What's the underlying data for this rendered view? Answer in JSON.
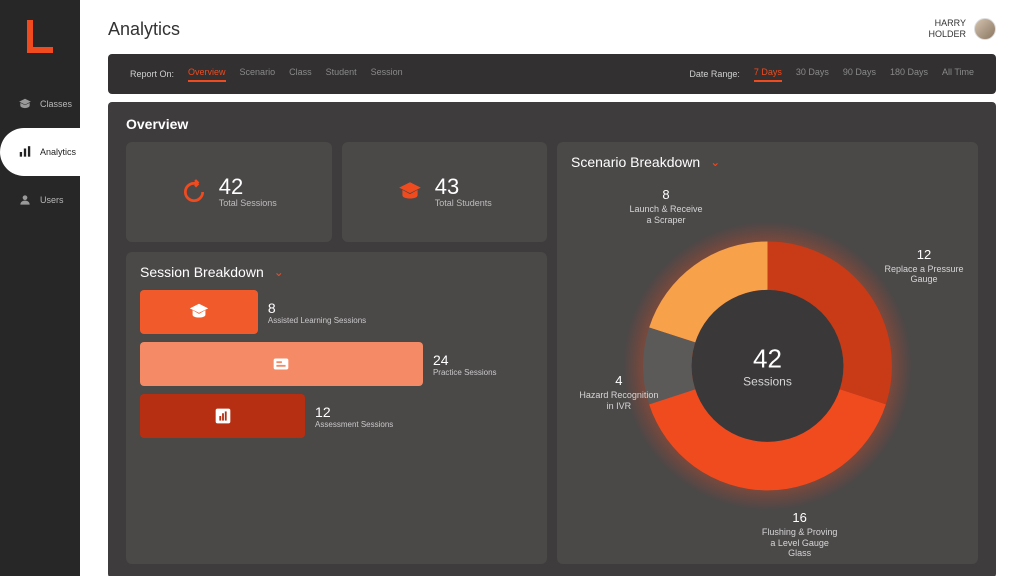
{
  "accent": "#f04b1f",
  "page_title": "Analytics",
  "user": {
    "first": "HARRY",
    "last": "HOLDER"
  },
  "sidebar": {
    "items": [
      {
        "label": "Classes",
        "icon": "classes-icon"
      },
      {
        "label": "Analytics",
        "icon": "analytics-icon"
      },
      {
        "label": "Users",
        "icon": "users-icon"
      }
    ],
    "active_index": 1
  },
  "filter": {
    "report_label": "Report On:",
    "report_opts": [
      "Overview",
      "Scenario",
      "Class",
      "Student",
      "Session"
    ],
    "report_active": 0,
    "date_label": "Date Range:",
    "date_opts": [
      "7 Days",
      "30 Days",
      "90 Days",
      "180 Days",
      "All Time"
    ],
    "date_active": 0
  },
  "overview": {
    "title": "Overview",
    "total_sessions": {
      "value": "42",
      "label": "Total Sessions"
    },
    "total_students": {
      "value": "43",
      "label": "Total Students"
    },
    "session_breakdown": {
      "title": "Session Breakdown",
      "bars": [
        {
          "value": "8",
          "label": "Assisted Learning Sessions",
          "color": "#f15a2b",
          "width_pct": 30
        },
        {
          "value": "24",
          "label": "Practice Sessions",
          "color": "#f58a66",
          "width_pct": 72
        },
        {
          "value": "12",
          "label": "Assessment Sessions",
          "color": "#b72f12",
          "width_pct": 42
        }
      ]
    },
    "scenario_breakdown": {
      "title": "Scenario Breakdown",
      "center_value": "42",
      "center_label": "Sessions",
      "slices": [
        {
          "value": "8",
          "label": "Launch & Receive a Scraper",
          "color": "#f7a14a"
        },
        {
          "value": "12",
          "label": "Replace a Pressure Gauge",
          "color": "#c93a17"
        },
        {
          "value": "16",
          "label": "Flushing & Proving a Level Gauge Glass",
          "color": "#f04b1f"
        },
        {
          "value": "4",
          "label": "Hazard Recognition in IVR",
          "color": "#5c5959"
        }
      ]
    }
  },
  "chart_data": [
    {
      "type": "bar",
      "title": "Session Breakdown",
      "categories": [
        "Assisted Learning Sessions",
        "Practice Sessions",
        "Assessment Sessions"
      ],
      "values": [
        8,
        24,
        12
      ],
      "orientation": "horizontal"
    },
    {
      "type": "pie",
      "title": "Scenario Breakdown",
      "total": 42,
      "series": [
        {
          "name": "Launch & Receive a Scraper",
          "value": 8
        },
        {
          "name": "Replace a Pressure Gauge",
          "value": 12
        },
        {
          "name": "Flushing & Proving a Level Gauge Glass",
          "value": 16
        },
        {
          "name": "Hazard Recognition in IVR",
          "value": 4
        }
      ]
    }
  ]
}
